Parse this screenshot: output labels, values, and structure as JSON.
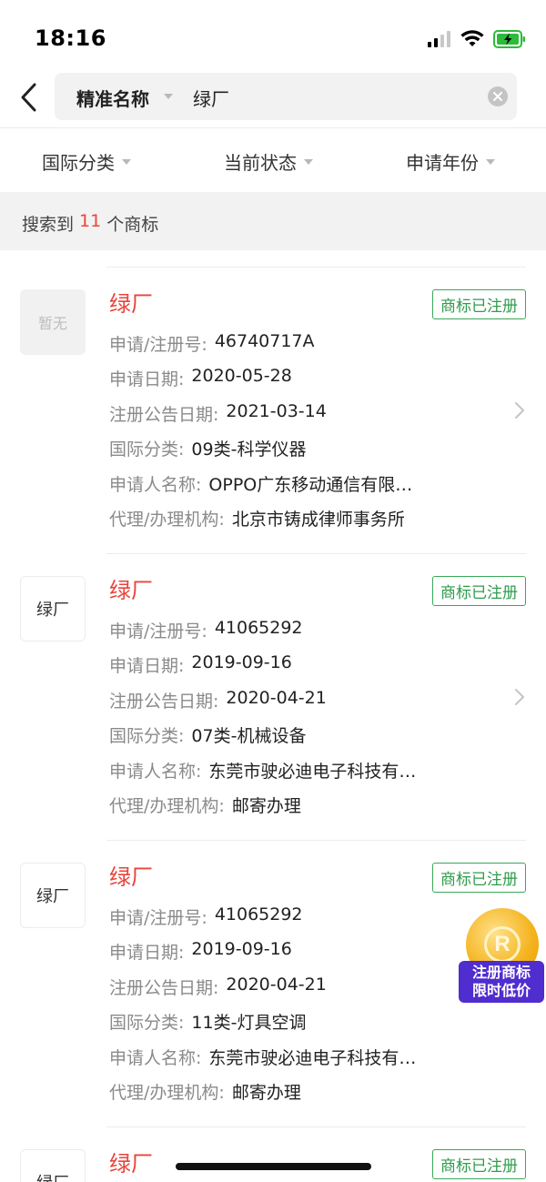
{
  "status_bar": {
    "time": "18:16"
  },
  "search": {
    "mode_label": "精准名称",
    "query": "绿厂"
  },
  "filters": [
    {
      "label": "国际分类"
    },
    {
      "label": "当前状态"
    },
    {
      "label": "申请年份"
    }
  ],
  "results": {
    "prefix": "搜索到",
    "count": "11",
    "suffix": "个商标"
  },
  "trademarks": [
    {
      "thumb": "暂无",
      "title": "绿厂",
      "status": "商标已注册",
      "fields": [
        {
          "label": "申请/注册号:",
          "value": "46740717A"
        },
        {
          "label": "申请日期:",
          "value": "2020-05-28"
        },
        {
          "label": "注册公告日期:",
          "value": "2021-03-14"
        },
        {
          "label": "国际分类:",
          "value": "09类-科学仪器"
        },
        {
          "label": "申请人名称:",
          "value": "OPPO广东移动通信有限…"
        },
        {
          "label": "代理/办理机构:",
          "value": "北京市铸成律师事务所"
        }
      ]
    },
    {
      "thumb": "绿厂",
      "title": "绿厂",
      "status": "商标已注册",
      "fields": [
        {
          "label": "申请/注册号:",
          "value": "41065292"
        },
        {
          "label": "申请日期:",
          "value": "2019-09-16"
        },
        {
          "label": "注册公告日期:",
          "value": "2020-04-21"
        },
        {
          "label": "国际分类:",
          "value": "07类-机械设备"
        },
        {
          "label": "申请人名称:",
          "value": "东莞市驶必迪电子科技有…"
        },
        {
          "label": "代理/办理机构:",
          "value": "邮寄办理"
        }
      ]
    },
    {
      "thumb": "绿厂",
      "title": "绿厂",
      "status": "商标已注册",
      "fields": [
        {
          "label": "申请/注册号:",
          "value": "41065292"
        },
        {
          "label": "申请日期:",
          "value": "2019-09-16"
        },
        {
          "label": "注册公告日期:",
          "value": "2020-04-21"
        },
        {
          "label": "国际分类:",
          "value": "11类-灯具空调"
        },
        {
          "label": "申请人名称:",
          "value": "东莞市驶必迪电子科技有…"
        },
        {
          "label": "代理/办理机构:",
          "value": "邮寄办理"
        }
      ]
    },
    {
      "thumb": "绿厂",
      "title": "绿厂",
      "status": "商标已注册",
      "fields": []
    }
  ],
  "promo": {
    "coin_symbol": "R",
    "line1": "注册商标",
    "line2": "限时低价"
  },
  "colors": {
    "accent_red": "#e8453c",
    "status_green": "#2e9c4b",
    "promo_purple": "#4f2dcf"
  }
}
